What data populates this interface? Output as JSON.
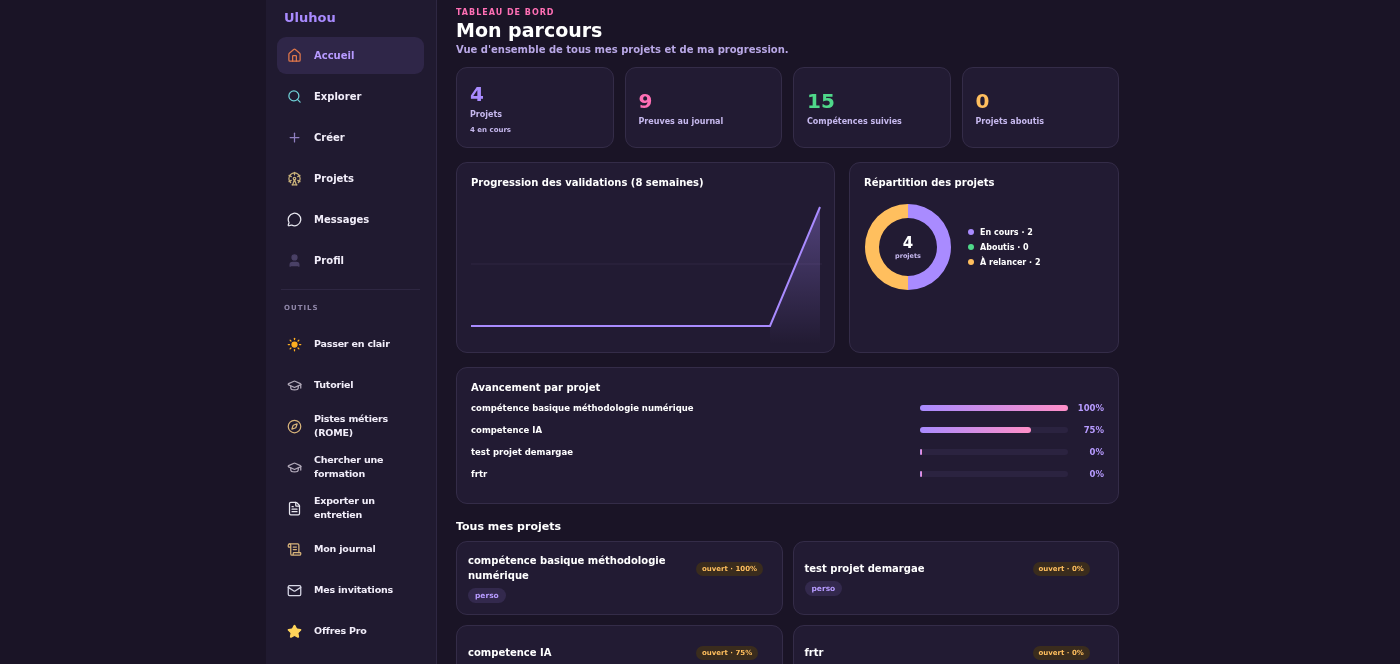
{
  "sidebar": {
    "brand": "Uluhou",
    "nav": [
      {
        "label": "Accueil",
        "selected": true
      },
      {
        "label": "Explorer",
        "selected": false
      },
      {
        "label": "Créer",
        "selected": false
      },
      {
        "label": "Projets",
        "selected": false
      },
      {
        "label": "Messages",
        "selected": false
      },
      {
        "label": "Profil",
        "selected": false
      }
    ],
    "tools_heading": "OUTILS",
    "tools": [
      {
        "label": "Passer en clair"
      },
      {
        "label": "Tutoriel"
      },
      {
        "label": "Pistes métiers (ROME)"
      },
      {
        "label": "Chercher une formation"
      },
      {
        "label": "Exporter un entretien"
      },
      {
        "label": "Mon journal"
      },
      {
        "label": "Mes invitations"
      },
      {
        "label": "Offres Pro"
      }
    ]
  },
  "header": {
    "eyebrow": "TABLEAU DE BORD",
    "title": "Mon parcours",
    "subtitle": "Vue d'ensemble de tous mes projets et de ma progression."
  },
  "stats": [
    {
      "value": "4",
      "label": "Projets",
      "note": "4 en cours",
      "color": "#a98bff"
    },
    {
      "value": "9",
      "label": "Preuves au journal",
      "color": "#ff6fb5"
    },
    {
      "value": "15",
      "label": "Compétences suivies",
      "color": "#4fd88a"
    },
    {
      "value": "0",
      "label": "Projets aboutis",
      "color": "#ffbf5e"
    }
  ],
  "progression": {
    "title": "Progression des validations (8 semaines)"
  },
  "distribution": {
    "title": "Répartition des projets",
    "total": "4",
    "total_label": "projets",
    "separator": "·",
    "legend": [
      {
        "name": "En cours",
        "count": "2",
        "color": "#a98bff"
      },
      {
        "name": "Aboutis",
        "count": "0",
        "color": "#4fd88a"
      },
      {
        "name": "À relancer",
        "count": "2",
        "color": "#ffbf5e"
      }
    ]
  },
  "advancement": {
    "title": "Avancement par projet",
    "rows": [
      {
        "name": "compétence basique méthodologie numérique",
        "level": 1,
        "reading": "100%"
      },
      {
        "name": "competence IA",
        "level": 0.75,
        "reading": "75%"
      },
      {
        "name": "test projet demargae",
        "level": 0,
        "reading": "0%"
      },
      {
        "name": "frtr",
        "level": 0,
        "reading": "0%"
      }
    ]
  },
  "projects": {
    "title": "Tous mes projets",
    "cards": [
      {
        "name": "compétence basique méthodologie numérique",
        "status": "ouvert · 100%",
        "tag": "perso"
      },
      {
        "name": "test projet demargae",
        "status": "ouvert · 0%",
        "tag": "perso"
      },
      {
        "name": "competence IA",
        "status": "ouvert · 75%"
      },
      {
        "name": "frtr",
        "status": "ouvert · 0%"
      }
    ]
  }
}
